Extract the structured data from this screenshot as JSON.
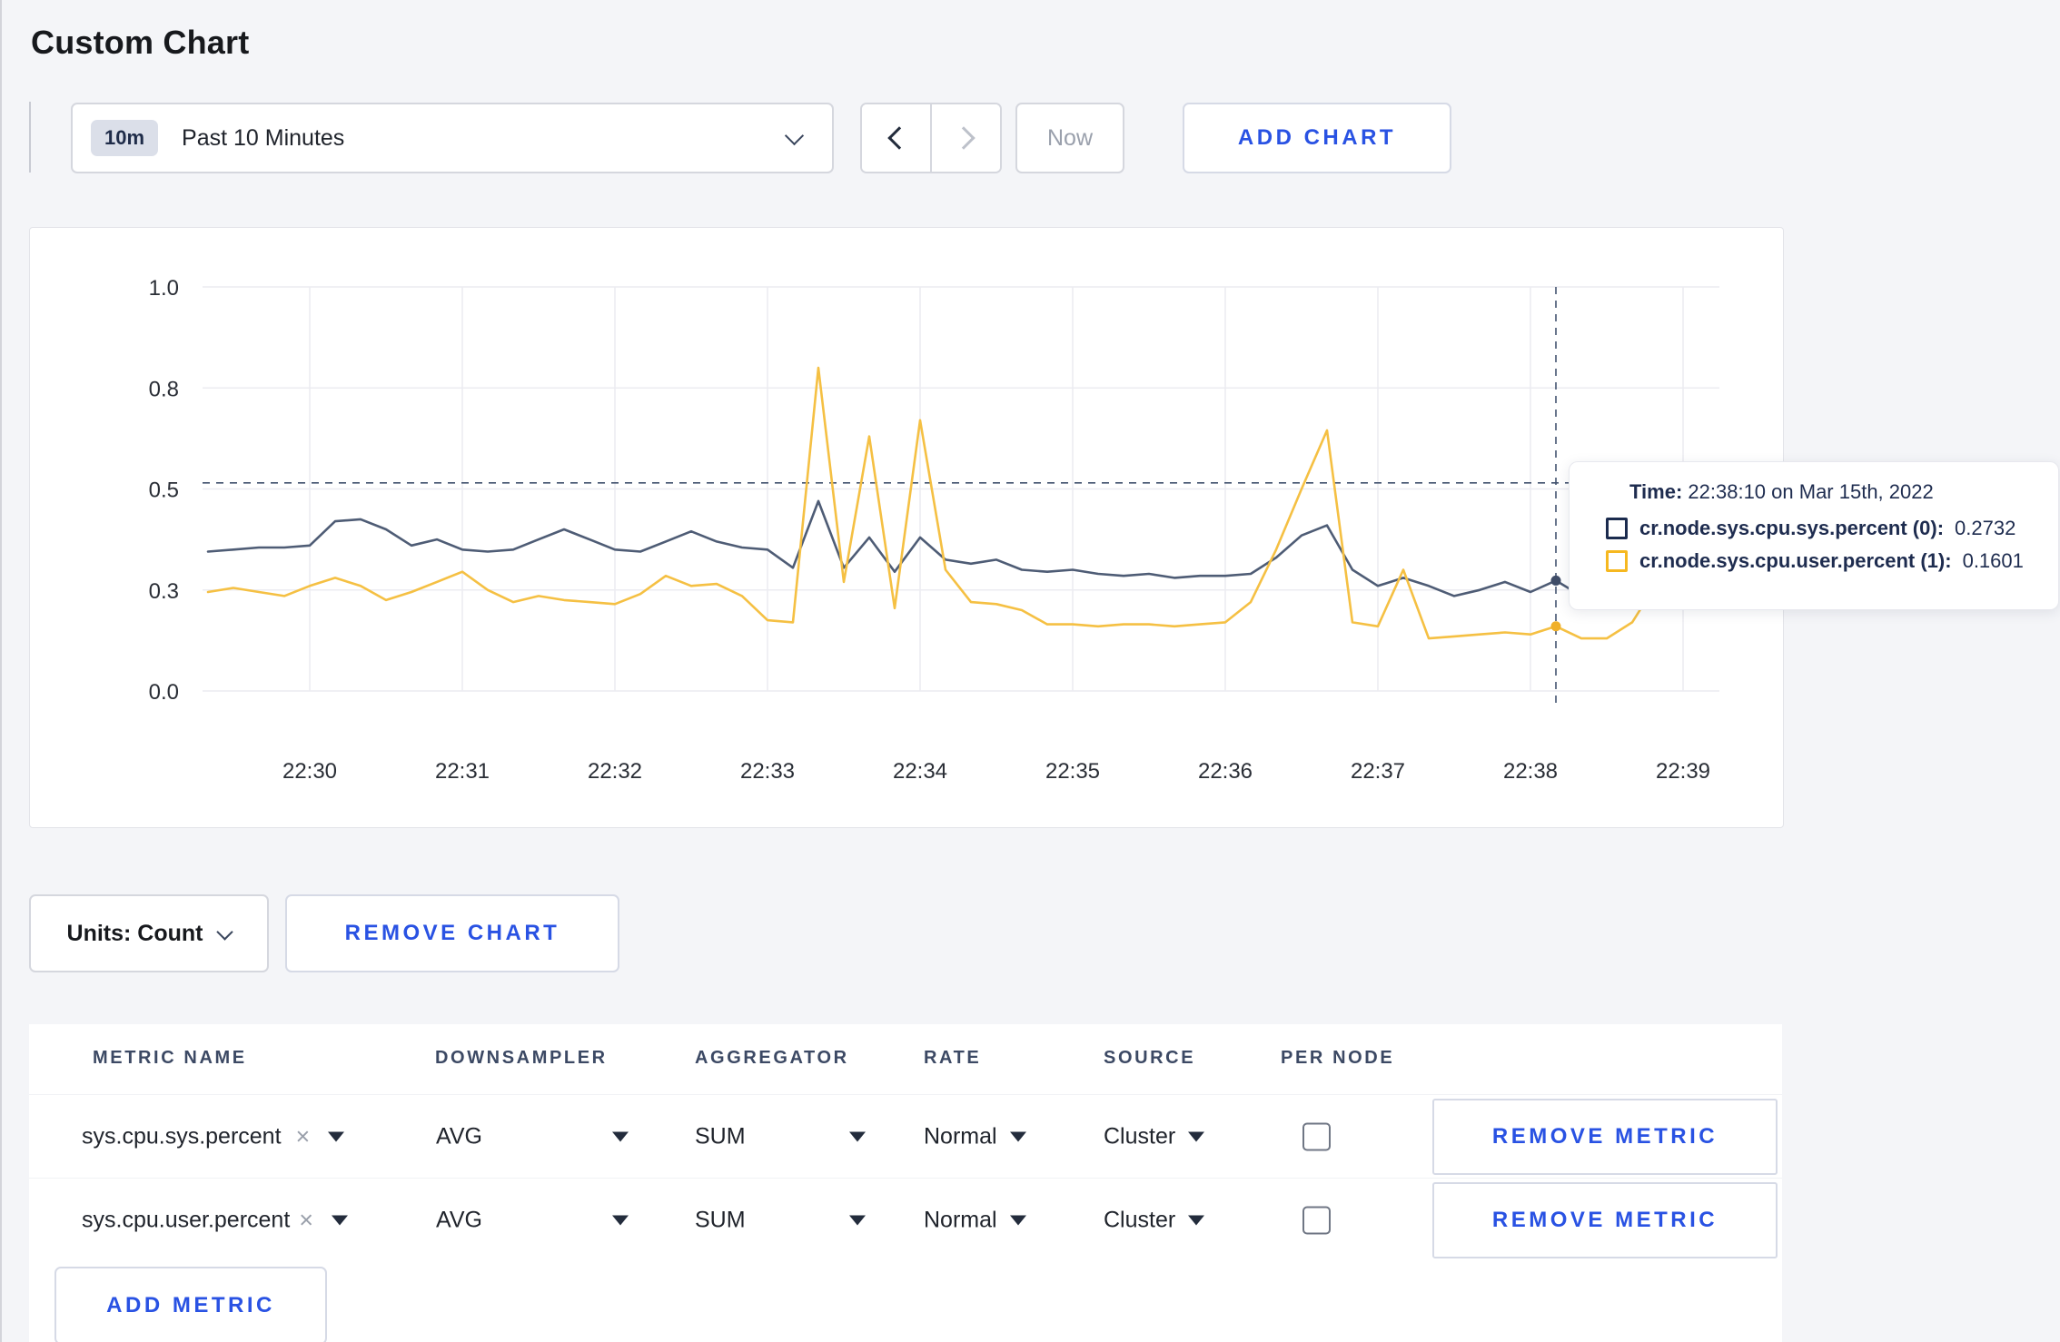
{
  "page": {
    "title": "Custom Chart",
    "background": "#f4f5f8",
    "accent_blue": "#2952e3"
  },
  "toolbar": {
    "time_range": {
      "badge": "10m",
      "label": "Past 10 Minutes"
    },
    "now_label": "Now",
    "add_chart_label": "ADD CHART"
  },
  "chart_data": {
    "type": "line",
    "grid": true,
    "legend": "none",
    "ylim": [
      0,
      1
    ],
    "y_ticks": [
      {
        "value": 0,
        "label": "0.0"
      },
      {
        "value": 0.25,
        "label": "0.3"
      },
      {
        "value": 0.5,
        "label": "0.5"
      },
      {
        "value": 0.75,
        "label": "0.8"
      },
      {
        "value": 1,
        "label": "1.0"
      }
    ],
    "x_ticks": [
      "22:30",
      "22:31",
      "22:32",
      "22:33",
      "22:34",
      "22:35",
      "22:36",
      "22:37",
      "22:38",
      "22:39"
    ],
    "x_start_minutes": -0.6667,
    "x_step_minutes": 0.16667,
    "grid_color": "#ececf1",
    "crosshair": {
      "color": "#42526e",
      "x_minutes": 8.1667,
      "time": "22:38:10",
      "y_value": 0.515,
      "dot_values": [
        0.2732,
        0.1601
      ]
    },
    "series": [
      {
        "name": "cr.node.sys.cpu.sys.percent (0)",
        "color": "#4e5c75",
        "dot_color": "#3f4d68",
        "values": [
          0.345,
          0.35,
          0.355,
          0.355,
          0.36,
          0.42,
          0.425,
          0.4,
          0.36,
          0.375,
          0.35,
          0.345,
          0.35,
          0.375,
          0.4,
          0.375,
          0.35,
          0.345,
          0.37,
          0.395,
          0.37,
          0.355,
          0.35,
          0.305,
          0.47,
          0.305,
          0.38,
          0.295,
          0.38,
          0.325,
          0.315,
          0.325,
          0.3,
          0.295,
          0.3,
          0.29,
          0.285,
          0.29,
          0.28,
          0.285,
          0.285,
          0.29,
          0.33,
          0.385,
          0.41,
          0.3,
          0.26,
          0.28,
          0.26,
          0.235,
          0.25,
          0.27,
          0.245,
          0.2732,
          0.235,
          0.22,
          0.24,
          0.25,
          0.24,
          0.23
        ]
      },
      {
        "name": "cr.node.sys.cpu.user.percent (1)",
        "color": "#f5c043",
        "dot_color": "#f0b02a",
        "values": [
          0.245,
          0.255,
          0.245,
          0.235,
          0.26,
          0.28,
          0.26,
          0.225,
          0.245,
          0.27,
          0.295,
          0.25,
          0.22,
          0.235,
          0.225,
          0.22,
          0.215,
          0.24,
          0.285,
          0.26,
          0.265,
          0.235,
          0.175,
          0.17,
          0.8,
          0.27,
          0.63,
          0.205,
          0.67,
          0.3,
          0.22,
          0.215,
          0.2,
          0.165,
          0.165,
          0.16,
          0.165,
          0.165,
          0.16,
          0.165,
          0.17,
          0.22,
          0.35,
          0.5,
          0.645,
          0.17,
          0.16,
          0.3,
          0.13,
          0.135,
          0.14,
          0.145,
          0.14,
          0.1601,
          0.13,
          0.13,
          0.17,
          0.27,
          0.27,
          0.215
        ]
      }
    ]
  },
  "tooltip": {
    "time_label": "Time:",
    "time_value": "22:38:10 on Mar 15th, 2022",
    "series": [
      {
        "label": "cr.node.sys.cpu.sys.percent (0):",
        "value": "0.2732",
        "swatch_color": "#1b2b4e"
      },
      {
        "label": "cr.node.sys.cpu.user.percent (1):",
        "value": "0.1601",
        "swatch_color": "#f6b820"
      }
    ]
  },
  "chart_controls": {
    "units_label": "Units: Count",
    "remove_chart_label": "REMOVE CHART"
  },
  "metrics_table": {
    "headers": [
      "METRIC NAME",
      "DOWNSAMPLER",
      "AGGREGATOR",
      "RATE",
      "SOURCE",
      "PER NODE"
    ],
    "rows": [
      {
        "metric": "sys.cpu.sys.percent",
        "downsampler": "AVG",
        "aggregator": "SUM",
        "rate": "Normal",
        "source": "Cluster",
        "per_node_checked": false,
        "remove_label": "REMOVE METRIC"
      },
      {
        "metric": "sys.cpu.user.percent",
        "downsampler": "AVG",
        "aggregator": "SUM",
        "rate": "Normal",
        "source": "Cluster",
        "per_node_checked": false,
        "remove_label": "REMOVE METRIC"
      }
    ],
    "add_metric_label": "ADD METRIC"
  }
}
